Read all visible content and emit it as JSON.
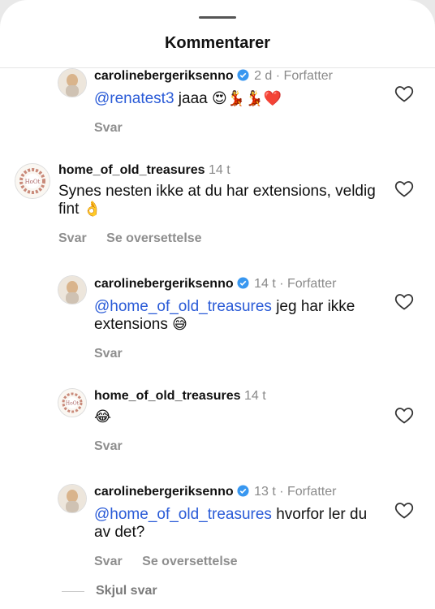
{
  "header": {
    "title": "Kommentarer"
  },
  "comments": [
    {
      "username": "carolinebergeriksenno",
      "verified": true,
      "time": "2 d",
      "author_tag": "Forfatter",
      "mention": "@renatest3",
      "text": " jaaa ",
      "emoji": "😍💃💃❤️",
      "reply_label": "Svar"
    },
    {
      "username": "home_of_old_treasures",
      "verified": false,
      "time": "14 t",
      "text": "Synes nesten ikke at du har extensions, veldig fint ",
      "emoji": "👌",
      "reply_label": "Svar",
      "translate_label": "Se oversettelse"
    },
    {
      "username": "carolinebergeriksenno",
      "verified": true,
      "time": "14 t",
      "author_tag": "Forfatter",
      "mention": "@home_of_old_treasures",
      "text": " jeg har ikke extensions ",
      "emoji": "😅",
      "reply_label": "Svar"
    },
    {
      "username": "home_of_old_treasures",
      "verified": false,
      "time": "14 t",
      "text": "",
      "emoji": "😂",
      "reply_label": "Svar"
    },
    {
      "username": "carolinebergeriksenno",
      "verified": true,
      "time": "13 t",
      "author_tag": "Forfatter",
      "mention": "@home_of_old_treasures",
      "text": " hvorfor ler du av det?",
      "emoji": "",
      "reply_label": "Svar",
      "translate_label": "Se oversettelse"
    }
  ],
  "hide_replies_label": "Skjul svar",
  "colors": {
    "mention": "#2a5bd7",
    "verified": "#3897f0",
    "secondary": "#8e8e8e"
  },
  "icons": {
    "like": "heart-outline-icon",
    "verified": "verified-badge-icon",
    "grabber": "drag-handle"
  }
}
